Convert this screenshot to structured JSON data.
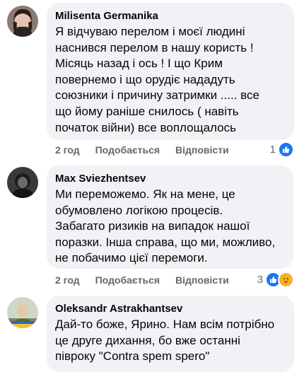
{
  "comments": [
    {
      "author": "Milisenta Germanika",
      "text": "Я відчуваю перелом і моєї людині\nнаснився перелом в нашу користь !\nМісяць назад і ось ! І що Крим\nповернемо і що орудіє нададуть\nсоюзники і причину затримки ..... все\nщо йому раніше снилось ( навіть\nпочаток війни) все воплощалось",
      "time": "2 год",
      "like_label": "Подобається",
      "reply_label": "Відповісти",
      "reaction_count": "1"
    },
    {
      "author": "Max Sviezhentsev",
      "text": "Ми переможемо. Як на мене, це\nобумовлено логікою процесів.\nЗабагато ризиків на випадок нашої\nпоразки. Інша справа, що ми, можливо,\nне побачимо цієї перемоги.",
      "time": "2 год",
      "like_label": "Подобається",
      "reply_label": "Відповісти",
      "reaction_count": "3"
    },
    {
      "author": "Oleksandr Astrakhantsev",
      "text": "Дай-то боже, Ярино. Нам всім потрібно\nце друге дихання, бо вже останні\nпівроку \"Contra spem spero\""
    }
  ],
  "colors": {
    "bubble": "#f0f2f5",
    "meta": "#65676b",
    "like_blue": "#1877f2",
    "care_yellow": "#f7b125"
  }
}
